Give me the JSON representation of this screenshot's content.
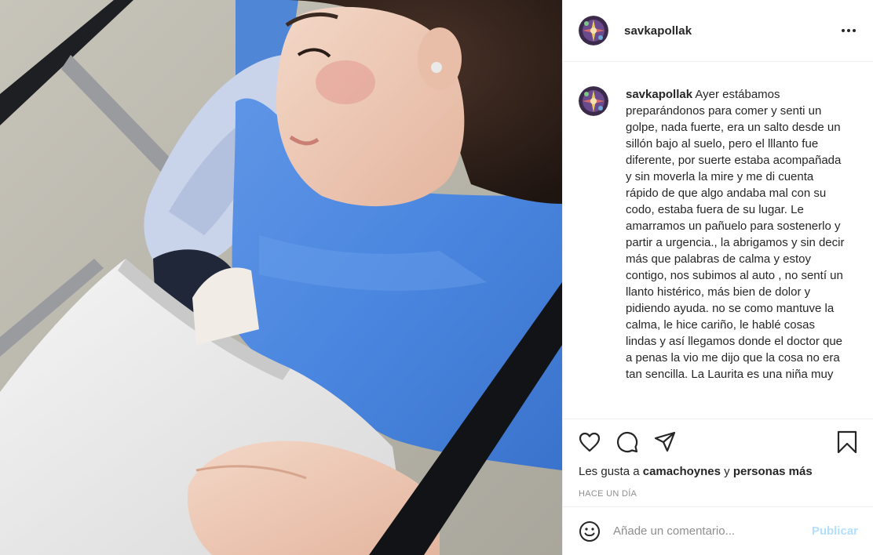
{
  "post": {
    "username": "savkapollak",
    "more_icon": "more-horizontal-icon",
    "caption_username": "savkapollak",
    "caption_text": "Ayer estábamos preparándonos para comer y senti un golpe, nada fuerte, era un salto desde un sillón bajo al suelo, pero el lllanto fue diferente, por suerte estaba acompañada y sin moverla la mire y me di cuenta rápido de que algo andaba mal con su codo, estaba fuera de su lugar. Le amarramos un pañuelo para sostenerlo y partir a urgencia., la abrigamos y sin decir más que palabras de calma y estoy contigo, nos subimos al auto , no sentí un llanto histérico, más bien de dolor y pidiendo ayuda. no se como mantuve la calma, le hice cariño, le hablé cosas lindas y así llegamos donde el doctor que a penas la vio me dijo que la cosa no era tan sencilla. La Laurita es una niña muy",
    "likes_prefix": "Les gusta a",
    "likes_user": "camachoynes",
    "likes_connector": "y",
    "likes_others": "personas más",
    "timestamp": "HACE UN DÍA"
  },
  "actions": {
    "like_icon": "heart-icon",
    "comment_icon": "comment-icon",
    "share_icon": "share-icon",
    "save_icon": "bookmark-icon"
  },
  "comment_box": {
    "emoji_icon": "emoji-icon",
    "placeholder": "Añade un comentario...",
    "value": "",
    "publish_label": "Publicar"
  },
  "colors": {
    "text": "#262626",
    "muted": "#8e8e8e",
    "border": "#efefef",
    "publish_disabled": "#b2dffc"
  }
}
